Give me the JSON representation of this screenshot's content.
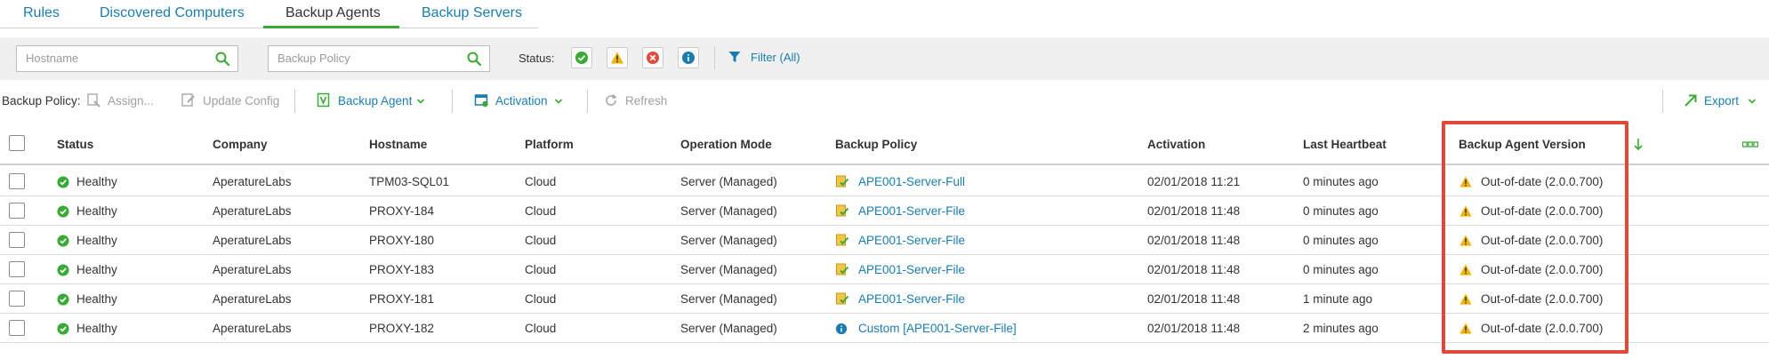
{
  "tabs": [
    {
      "label": "Rules",
      "active": false
    },
    {
      "label": "Discovered Computers",
      "active": false
    },
    {
      "label": "Backup Agents",
      "active": true
    },
    {
      "label": "Backup Servers",
      "active": false
    }
  ],
  "filter": {
    "hostname_placeholder": "Hostname",
    "policy_placeholder": "Backup Policy",
    "status_label": "Status:",
    "filter_label": "Filter (All)"
  },
  "toolbar": {
    "backup_policy_label": "Backup Policy:",
    "assign": "Assign...",
    "update_config": "Update Config",
    "backup_agent": "Backup Agent",
    "activation": "Activation",
    "refresh": "Refresh",
    "export": "Export"
  },
  "table": {
    "columns": [
      "Status",
      "Company",
      "Hostname",
      "Platform",
      "Operation Mode",
      "Backup Policy",
      "Activation",
      "Last Heartbeat",
      "Backup Agent Version"
    ],
    "rows": [
      {
        "status": "Healthy",
        "company": "AperatureLabs",
        "hostname": "TPM03-SQL01",
        "platform": "Cloud",
        "mode": "Server (Managed)",
        "policy": "APE001-Server-Full",
        "policy_icon": "policy-icon",
        "activation": "02/01/2018 11:21",
        "heartbeat": "0 minutes ago",
        "version": "Out-of-date (2.0.0.700)"
      },
      {
        "status": "Healthy",
        "company": "AperatureLabs",
        "hostname": "PROXY-184",
        "platform": "Cloud",
        "mode": "Server (Managed)",
        "policy": "APE001-Server-File",
        "policy_icon": "policy-icon",
        "activation": "02/01/2018 11:48",
        "heartbeat": "0 minutes ago",
        "version": "Out-of-date (2.0.0.700)"
      },
      {
        "status": "Healthy",
        "company": "AperatureLabs",
        "hostname": "PROXY-180",
        "platform": "Cloud",
        "mode": "Server (Managed)",
        "policy": "APE001-Server-File",
        "policy_icon": "policy-icon",
        "activation": "02/01/2018 11:48",
        "heartbeat": "0 minutes ago",
        "version": "Out-of-date (2.0.0.700)"
      },
      {
        "status": "Healthy",
        "company": "AperatureLabs",
        "hostname": "PROXY-183",
        "platform": "Cloud",
        "mode": "Server (Managed)",
        "policy": "APE001-Server-File",
        "policy_icon": "policy-icon",
        "activation": "02/01/2018 11:48",
        "heartbeat": "0 minutes ago",
        "version": "Out-of-date (2.0.0.700)"
      },
      {
        "status": "Healthy",
        "company": "AperatureLabs",
        "hostname": "PROXY-181",
        "platform": "Cloud",
        "mode": "Server (Managed)",
        "policy": "APE001-Server-File",
        "policy_icon": "policy-icon",
        "activation": "02/01/2018 11:48",
        "heartbeat": "1 minute ago",
        "version": "Out-of-date (2.0.0.700)"
      },
      {
        "status": "Healthy",
        "company": "AperatureLabs",
        "hostname": "PROXY-182",
        "platform": "Cloud",
        "mode": "Server (Managed)",
        "policy": "Custom [APE001-Server-File]",
        "policy_icon": "info-icon",
        "activation": "02/01/2018 11:48",
        "heartbeat": "2 minutes ago",
        "version": "Out-of-date (2.0.0.700)"
      }
    ]
  },
  "colors": {
    "link": "#1a7dad",
    "accent_green": "#3aa935",
    "warning": "#f0b400",
    "error": "#e24a3b",
    "highlight": "#e0483a"
  }
}
